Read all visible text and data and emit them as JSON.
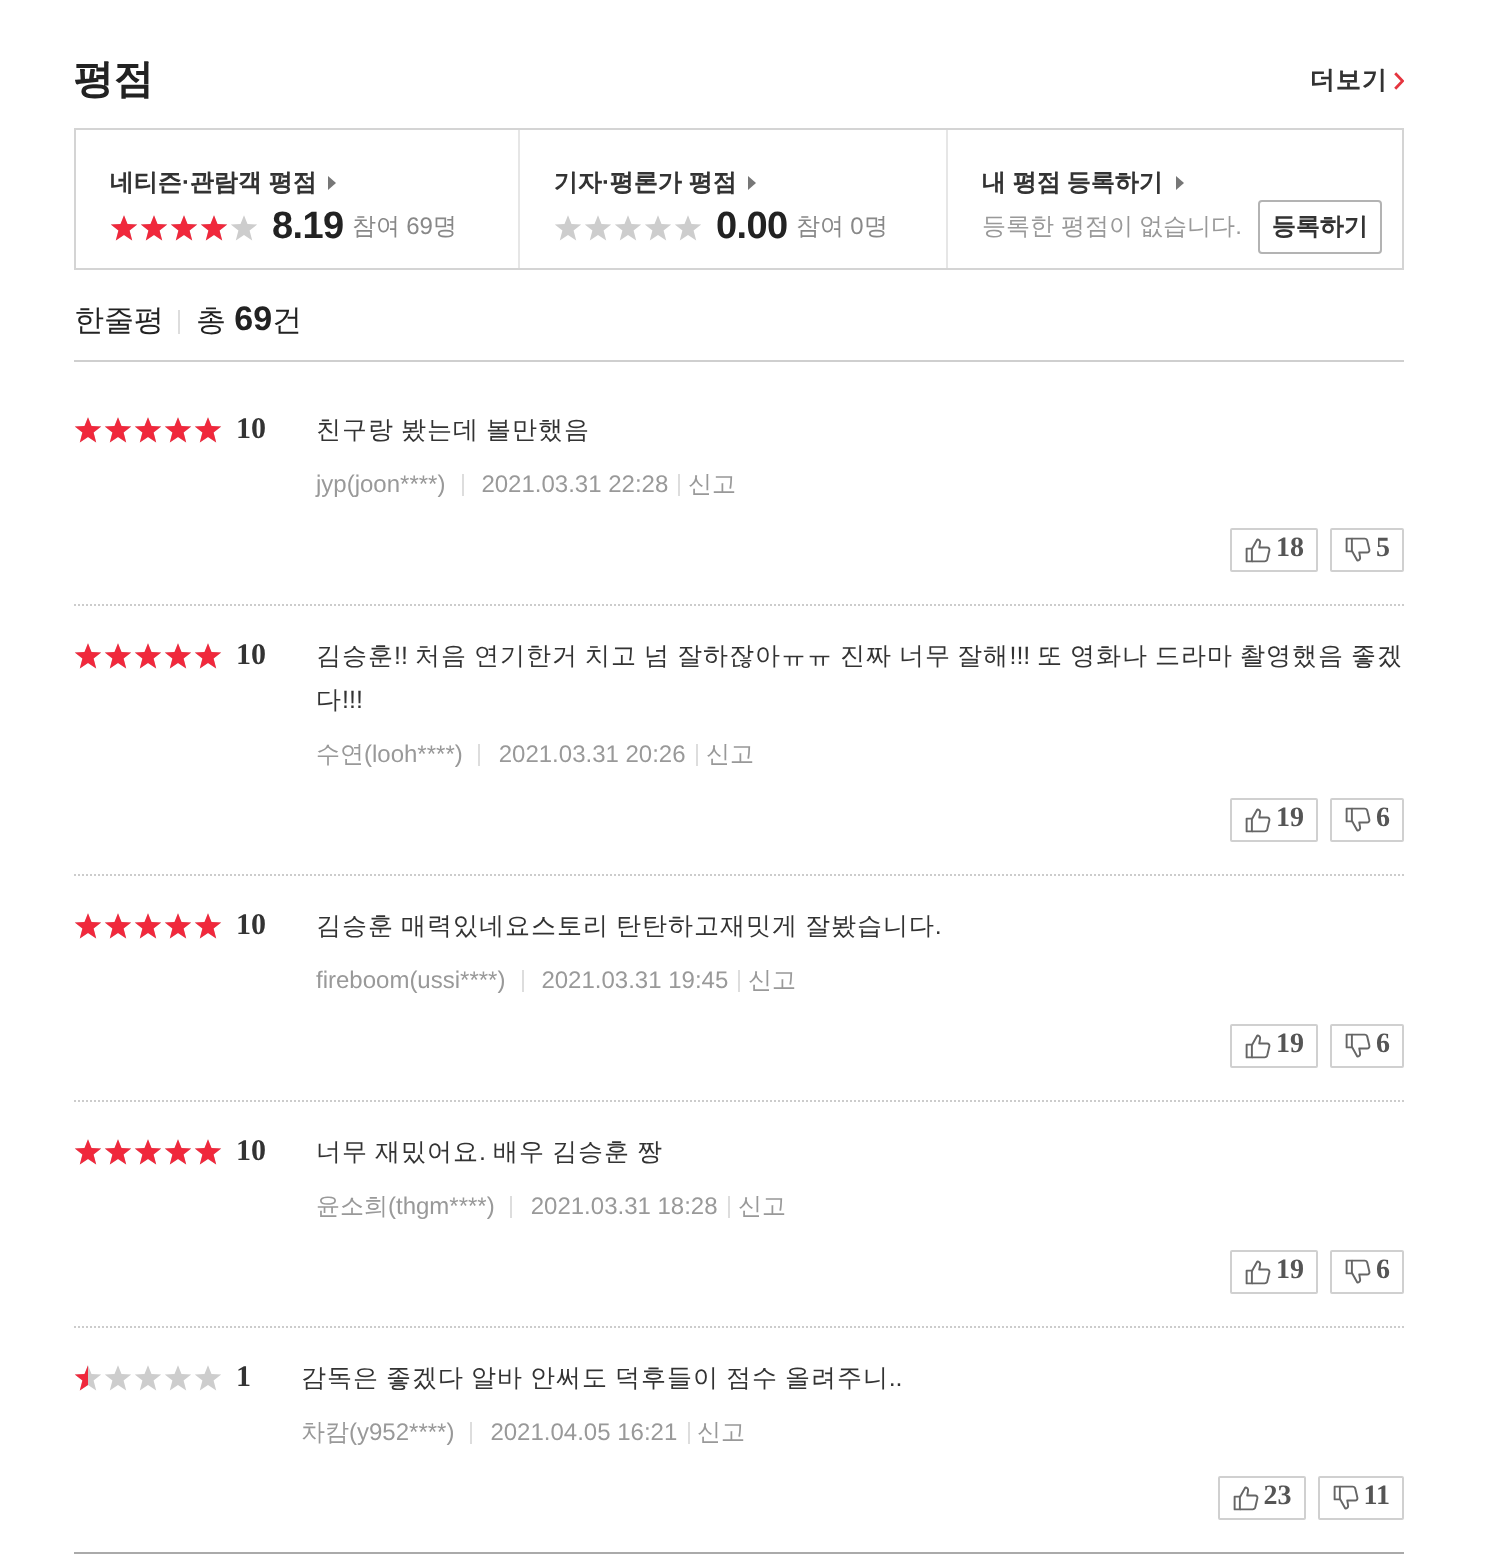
{
  "section": {
    "title": "평점",
    "more_link": "더보기"
  },
  "summary": [
    {
      "kind": "score",
      "label": "네티즌·관람객 평점",
      "stars": 4,
      "score": "8.19",
      "participants": "참여 69명"
    },
    {
      "kind": "score",
      "label": "기자·평론가 평점",
      "stars": 0,
      "score": "0.00",
      "participants": "참여 0명"
    },
    {
      "kind": "register",
      "label": "내 평점 등록하기",
      "message": "등록한 평점이 없습니다.",
      "button": "등록하기"
    }
  ],
  "reviews_header": {
    "title": "한줄평",
    "total": "총 **69**건"
  },
  "reviews": [
    {
      "stars": 5,
      "score": "10",
      "text": "친구랑 봤는데 볼만했음",
      "author": "jyp(joon****)",
      "date": "2021.03.31 22:28",
      "report": "신고",
      "likes": "18",
      "dislikes": "5"
    },
    {
      "stars": 5,
      "score": "10",
      "text": "김승훈!! 처음 연기한거 치고 넘 잘하잖아ㅠㅠ 진짜 너무 잘해!!! 또 영화나 드라마 촬영했음 좋겠다!!!",
      "author": "수연(looh****)",
      "date": "2021.03.31 20:26",
      "report": "신고",
      "likes": "19",
      "dislikes": "6"
    },
    {
      "stars": 5,
      "score": "10",
      "text": "김승훈 매력있네요스토리 탄탄하고재밋게 잘봤습니다.",
      "author": "fireboom(ussi****)",
      "date": "2021.03.31 19:45",
      "report": "신고",
      "likes": "19",
      "dislikes": "6"
    },
    {
      "stars": 5,
      "score": "10",
      "text": "너무 재밌어요. 배우 김승훈 짱",
      "author": "윤소희(thgm****)",
      "date": "2021.03.31 18:28",
      "report": "신고",
      "likes": "19",
      "dislikes": "6"
    },
    {
      "stars": 0.5,
      "score": "1",
      "text": "감독은 좋겠다 알바 안써도 덕후들이 점수 올려주니..",
      "author": "차캄(y952****)",
      "date": "2021.04.05 16:21",
      "report": "신고",
      "likes": "23",
      "dislikes": "11"
    }
  ]
}
